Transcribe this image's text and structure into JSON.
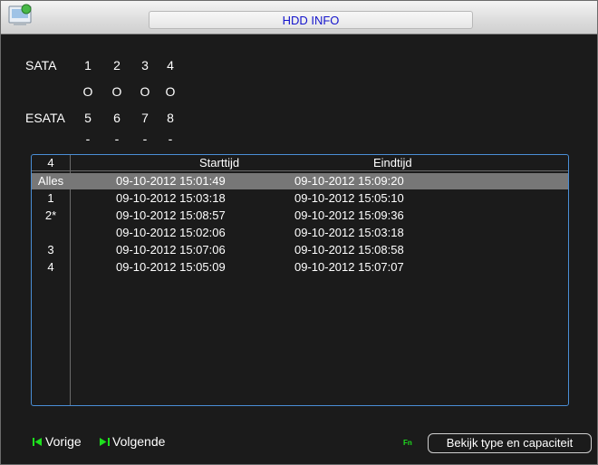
{
  "window": {
    "title": "HDD INFO"
  },
  "disks": {
    "sata_label": "SATA",
    "sata_ports": [
      "1",
      "2",
      "3",
      "4"
    ],
    "sata_status": [
      "O",
      "O",
      "O",
      "O"
    ],
    "esata_label": "ESATA",
    "esata_ports": [
      "5",
      "6",
      "7",
      "8"
    ],
    "esata_status": [
      "-",
      "-",
      "-",
      "-"
    ]
  },
  "table": {
    "columns": [
      "4",
      "Starttijd",
      "Eindtijd"
    ],
    "rows": [
      {
        "idx": "Alles",
        "start": "09-10-2012 15:01:49",
        "end": "09-10-2012 15:09:20",
        "selected": true
      },
      {
        "idx": "1",
        "start": "09-10-2012 15:03:18",
        "end": "09-10-2012 15:05:10"
      },
      {
        "idx": "2*",
        "start": "09-10-2012 15:08:57",
        "end": "09-10-2012 15:09:36"
      },
      {
        "idx": "",
        "start": "09-10-2012 15:02:06",
        "end": "09-10-2012 15:03:18"
      },
      {
        "idx": "3",
        "start": "09-10-2012 15:07:06",
        "end": "09-10-2012 15:08:58"
      },
      {
        "idx": "4",
        "start": "09-10-2012 15:05:09",
        "end": "09-10-2012 15:07:07"
      }
    ]
  },
  "footer": {
    "prev_label": "Vorige",
    "next_label": "Volgende",
    "fn_label": "Fn",
    "capacity_button": "Bekijk type en capaciteit"
  },
  "colors": {
    "accent_border": "#4a8ed6",
    "title_text": "#1414cc",
    "nav_icon": "#1ee01e",
    "selected_row": "#777777"
  }
}
